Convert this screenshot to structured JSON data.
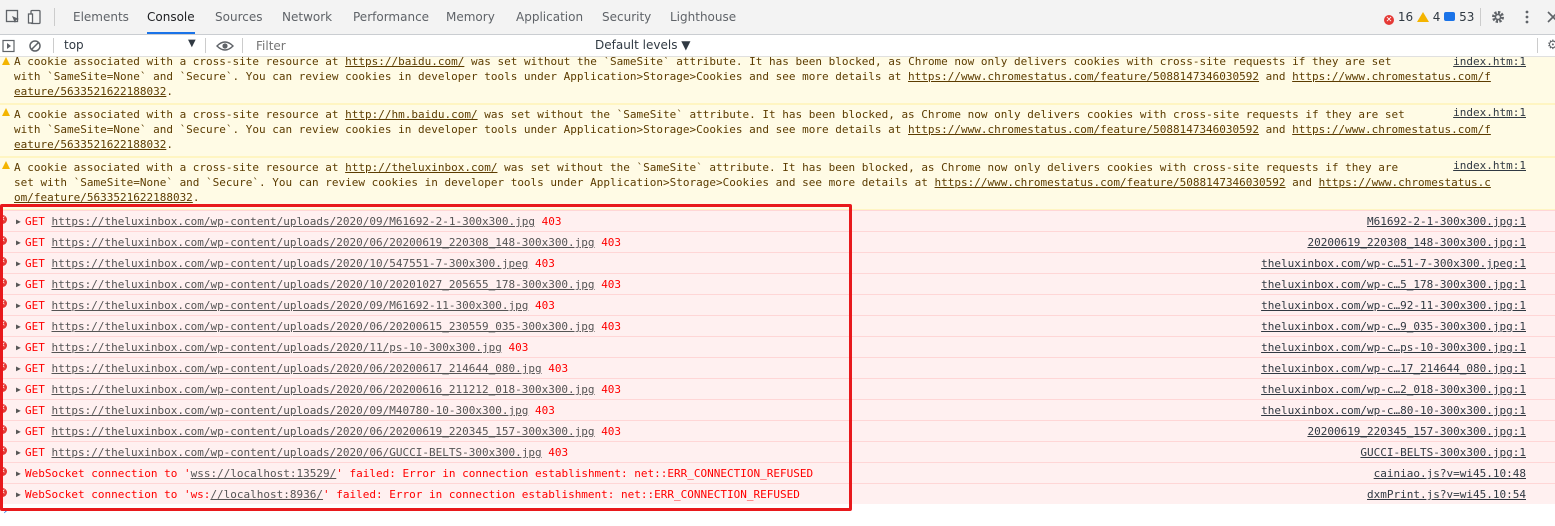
{
  "tabs": [
    "Elements",
    "Console",
    "Sources",
    "Network",
    "Performance",
    "Memory",
    "Application",
    "Security",
    "Lighthouse"
  ],
  "active_tab": "Console",
  "counts": {
    "errors": "16",
    "warnings": "4",
    "messages": "53"
  },
  "filterbar": {
    "context": "top",
    "filter_placeholder": "Filter",
    "levels": "Default levels ▼"
  },
  "warnings": [
    {
      "text_a": "A cookie associated with a cross-site resource at ",
      "url": "https://baidu.com/",
      "text_b": " was set without the `SameSite` attribute. It has been blocked, as Chrome now only delivers cookies with cross-site requests if they are set ",
      "line2": "with `SameSite=None` and `Secure`. You can review cookies in developer tools under Application>Storage>Cookies and see more details at ",
      "link1": "https://www.chromestatus.com/feature/5088147346030592",
      "and": " and ",
      "link2a": "https://www.chromestatus.com/f",
      "link2b": "eature/5633521622188032",
      "end": ".",
      "source": "index.htm:1"
    },
    {
      "text_a": "A cookie associated with a cross-site resource at ",
      "url": "http://hm.baidu.com/",
      "text_b": " was set without the `SameSite` attribute. It has been blocked, as Chrome now only delivers cookies with cross-site requests if they are set ",
      "line2": "with `SameSite=None` and `Secure`. You can review cookies in developer tools under Application>Storage>Cookies and see more details at ",
      "link1": "https://www.chromestatus.com/feature/5088147346030592",
      "and": " and ",
      "link2a": "https://www.chromestatus.com/f",
      "link2b": "eature/5633521622188032",
      "end": ".",
      "source": "index.htm:1"
    },
    {
      "text_a": "A cookie associated with a cross-site resource at ",
      "url": "http://theluxinbox.com/",
      "text_b": " was set without the `SameSite` attribute. It has been blocked, as Chrome now only delivers cookies with cross-site requests if they are ",
      "line2": "set with `SameSite=None` and `Secure`. You can review cookies in developer tools under Application>Storage>Cookies and see more details at ",
      "link1": "https://www.chromestatus.com/feature/5088147346030592",
      "and": " and ",
      "link2a": "https://www.chromestatus.c",
      "link2b": "om/feature/5633521622188032",
      "end": ".",
      "source": "index.htm:1"
    }
  ],
  "errors": [
    {
      "method": "GET",
      "url": "https://theluxinbox.com/wp-content/uploads/2020/09/M61692-2-1-300x300.jpg",
      "status": "403",
      "source": "M61692-2-1-300x300.jpg:1"
    },
    {
      "method": "GET",
      "url": "https://theluxinbox.com/wp-content/uploads/2020/06/20200619_220308_148-300x300.jpg",
      "status": "403",
      "source": "20200619_220308_148-300x300.jpg:1"
    },
    {
      "method": "GET",
      "url": "https://theluxinbox.com/wp-content/uploads/2020/10/547551-7-300x300.jpeg",
      "status": "403",
      "source": "theluxinbox.com/wp-c…51-7-300x300.jpeg:1"
    },
    {
      "method": "GET",
      "url": "https://theluxinbox.com/wp-content/uploads/2020/10/20201027_205655_178-300x300.jpg",
      "status": "403",
      "source": "theluxinbox.com/wp-c…5_178-300x300.jpg:1"
    },
    {
      "method": "GET",
      "url": "https://theluxinbox.com/wp-content/uploads/2020/09/M61692-11-300x300.jpg",
      "status": "403",
      "source": "theluxinbox.com/wp-c…92-11-300x300.jpg:1"
    },
    {
      "method": "GET",
      "url": "https://theluxinbox.com/wp-content/uploads/2020/06/20200615_230559_035-300x300.jpg",
      "status": "403",
      "source": "theluxinbox.com/wp-c…9_035-300x300.jpg:1"
    },
    {
      "method": "GET",
      "url": "https://theluxinbox.com/wp-content/uploads/2020/11/ps-10-300x300.jpg",
      "status": "403",
      "source": "theluxinbox.com/wp-c…ps-10-300x300.jpg:1"
    },
    {
      "method": "GET",
      "url": "https://theluxinbox.com/wp-content/uploads/2020/06/20200617_214644_080.jpg",
      "status": "403",
      "source": "theluxinbox.com/wp-c…17_214644_080.jpg:1"
    },
    {
      "method": "GET",
      "url": "https://theluxinbox.com/wp-content/uploads/2020/06/20200616_211212_018-300x300.jpg",
      "status": "403",
      "source": "theluxinbox.com/wp-c…2_018-300x300.jpg:1"
    },
    {
      "method": "GET",
      "url": "https://theluxinbox.com/wp-content/uploads/2020/09/M40780-10-300x300.jpg",
      "status": "403",
      "source": "theluxinbox.com/wp-c…80-10-300x300.jpg:1"
    },
    {
      "method": "GET",
      "url": "https://theluxinbox.com/wp-content/uploads/2020/06/20200619_220345_157-300x300.jpg",
      "status": "403",
      "source": "20200619_220345_157-300x300.jpg:1"
    },
    {
      "method": "GET",
      "url": "https://theluxinbox.com/wp-content/uploads/2020/06/GUCCI-BELTS-300x300.jpg",
      "status": "403",
      "source": "GUCCI-BELTS-300x300.jpg:1"
    }
  ],
  "ws_errors": [
    {
      "pre": "WebSocket connection to '",
      "url": "wss://localhost:13529/",
      "post": "' failed: Error in connection establishment: net::ERR_CONNECTION_REFUSED",
      "source": "cainiao.js?v=wi45.10:48"
    },
    {
      "pre": "WebSocket connection to 'ws:",
      "url": "//localhost:8936/",
      "post": "' failed: Error in connection establishment: net::ERR_CONNECTION_REFUSED",
      "source": "dxmPrint.js?v=wi45.10:54"
    }
  ],
  "prompt": "›",
  "colors": {
    "error_text": "#ff0000",
    "warning_bg": "#fffbe5",
    "highlight": "#e8191c",
    "accent": "#1a73e8"
  }
}
